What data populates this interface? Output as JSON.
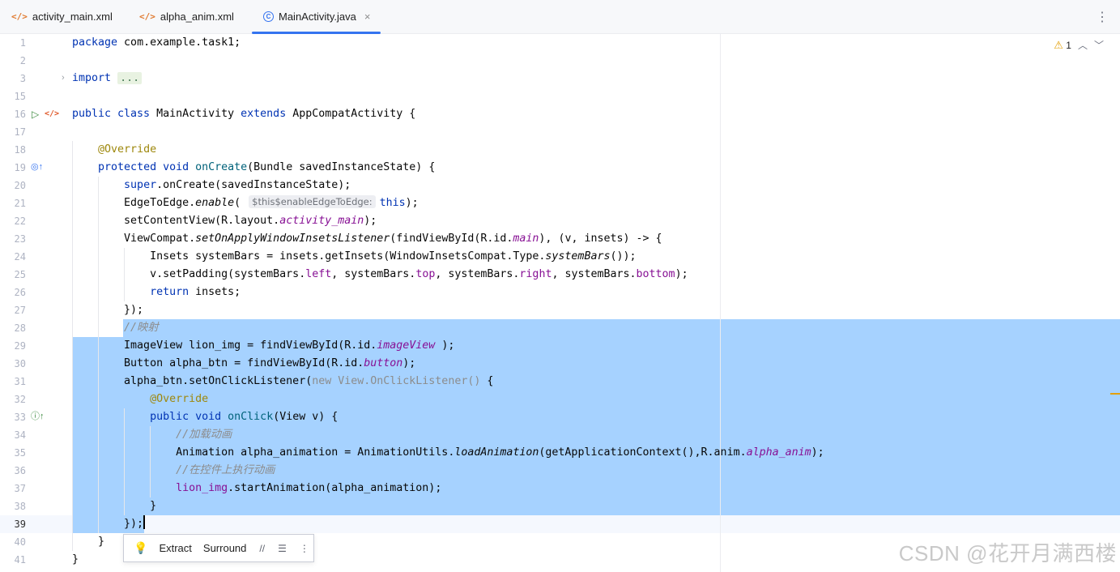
{
  "tabs": [
    {
      "label": "activity_main.xml",
      "icon": "xml-file-icon",
      "active": false
    },
    {
      "label": "alpha_anim.xml",
      "icon": "xml-file-icon",
      "active": false
    },
    {
      "label": "MainActivity.java",
      "icon": "java-class-icon",
      "active": true
    }
  ],
  "tab_close": "×",
  "warnings": {
    "count": "1"
  },
  "fold_placeholder": "...",
  "inlay_hint": "$this$enableEdgeToEdge:",
  "gutter": [
    "1",
    "2",
    "3",
    "15",
    "16",
    "17",
    "18",
    "19",
    "20",
    "21",
    "22",
    "23",
    "24",
    "25",
    "26",
    "27",
    "28",
    "29",
    "30",
    "31",
    "32",
    "33",
    "34",
    "35",
    "36",
    "37",
    "38",
    "39",
    "40",
    "41"
  ],
  "toolbar": {
    "extract": "Extract",
    "surround": "Surround"
  },
  "watermark": "CSDN @花开月满西楼",
  "colors": {
    "selection": "#a6d2ff",
    "keyword": "#0033b3",
    "annotation": "#9e880d",
    "accent": "#3574f0"
  }
}
